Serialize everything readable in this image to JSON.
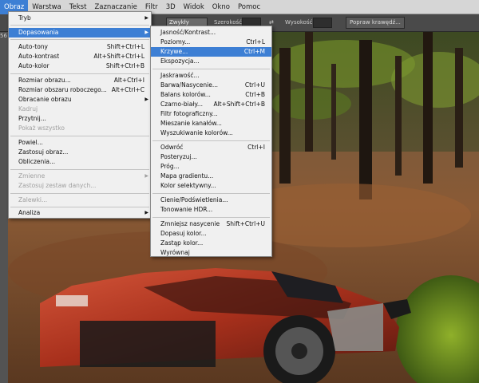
{
  "menubar": {
    "items": [
      "Obraz",
      "Warstwa",
      "Tekst",
      "Zaznaczanie",
      "Filtr",
      "3D",
      "Widok",
      "Okno",
      "Pomoc"
    ]
  },
  "optbar": {
    "style_label": "Zwykły",
    "width_label": "Szerokość:",
    "height_label": "Wysokość:",
    "refine_button": "Popraw krawędź..."
  },
  "tab": {
    "zoom_partial": "56"
  },
  "obraz_menu": {
    "tryb": "Tryb",
    "dopasowania": "Dopasowania",
    "autotony": "Auto-tony",
    "autotony_sc": "Shift+Ctrl+L",
    "autokontrast": "Auto-kontrast",
    "autokontrast_sc": "Alt+Shift+Ctrl+L",
    "autokolor": "Auto-kolor",
    "autokolor_sc": "Shift+Ctrl+B",
    "rozmiar_obrazu": "Rozmiar obrazu...",
    "rozmiar_obrazu_sc": "Alt+Ctrl+I",
    "rozmiar_roboczego": "Rozmiar obszaru roboczego...",
    "rozmiar_roboczego_sc": "Alt+Ctrl+C",
    "obracanie": "Obracanie obrazu",
    "kadruj": "Kadruj",
    "przytnij": "Przytnij...",
    "pokaz": "Pokaż wszystko",
    "powiel": "Powiel...",
    "zastosuj": "Zastosuj obraz...",
    "obliczenia": "Obliczenia...",
    "zmienne": "Zmienne",
    "zastosuj_zestaw": "Zastosuj zestaw danych...",
    "zalewki": "Zalewki...",
    "analiza": "Analiza"
  },
  "dopasowania_menu": {
    "jasnosc": "Jasność/Kontrast...",
    "poziomy": "Poziomy...",
    "poziomy_sc": "Ctrl+L",
    "krzywe": "Krzywe...",
    "krzywe_sc": "Ctrl+M",
    "ekspozycja": "Ekspozycja...",
    "jaskrawosc": "Jaskrawość...",
    "barwa": "Barwa/Nasycenie...",
    "barwa_sc": "Ctrl+U",
    "balans": "Balans kolorów...",
    "balans_sc": "Ctrl+B",
    "czarno_bialy": "Czarno-biały...",
    "czarno_bialy_sc": "Alt+Shift+Ctrl+B",
    "filtr": "Filtr fotograficzny...",
    "mieszanie": "Mieszanie kanałów...",
    "wyszukiwanie": "Wyszukiwanie kolorów...",
    "odwroc": "Odwróć",
    "odwroc_sc": "Ctrl+I",
    "posteryzuj": "Posteryzuj...",
    "prog": "Próg...",
    "mapa": "Mapa gradientu...",
    "kolor_selektywny": "Kolor selektywny...",
    "cienie": "Cienie/Podświetlenia...",
    "tonowanie": "Tonowanie HDR...",
    "zmniejsz": "Zmniejsz nasycenie",
    "zmniejsz_sc": "Shift+Ctrl+U",
    "dopasuj": "Dopasuj kolor...",
    "zastap": "Zastąp kolor...",
    "wyrownaj": "Wyrównaj"
  },
  "colors": {
    "highlight": "#3d7fd4",
    "menu_bg": "#f0f0f0",
    "car": "#b8391f"
  }
}
